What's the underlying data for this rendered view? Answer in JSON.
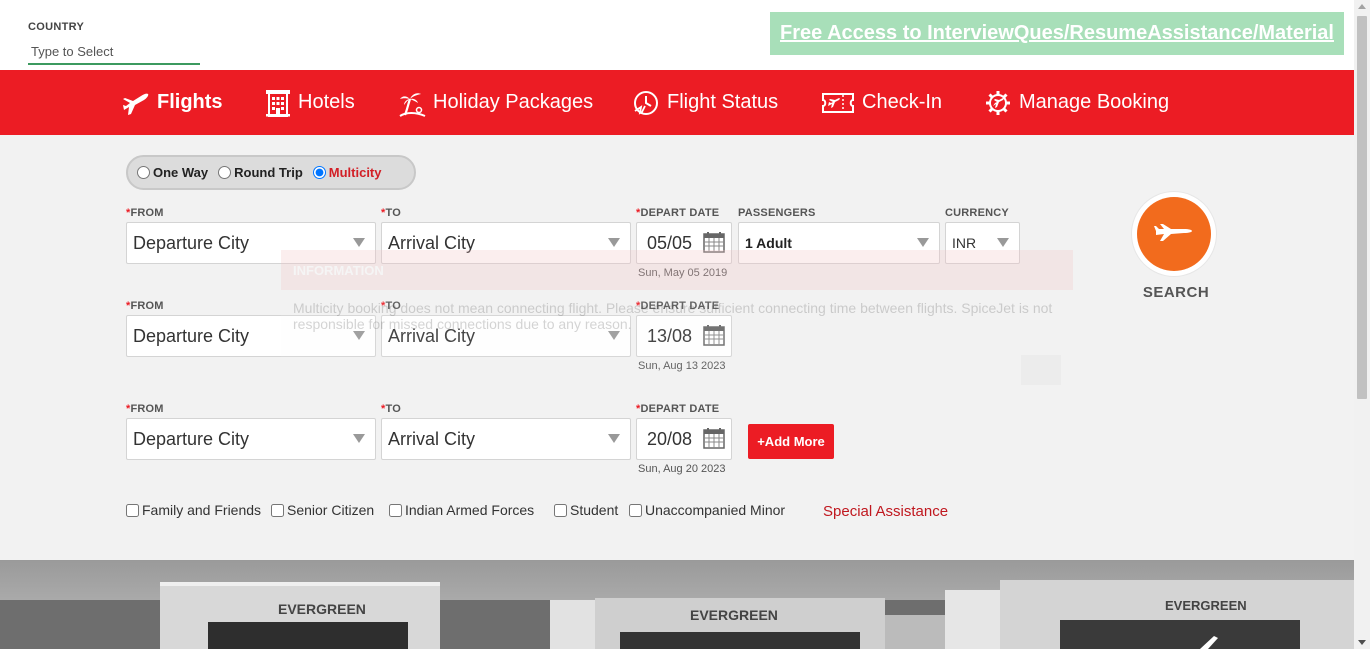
{
  "country": {
    "label": "COUNTRY",
    "placeholder": "Type to Select"
  },
  "promo": {
    "text": "Free Access to InterviewQues/ResumeAssistance/Material"
  },
  "nav": {
    "flights": "Flights",
    "hotels": "Hotels",
    "holiday": "Holiday Packages",
    "flight_status": "Flight Status",
    "checkin": "Check-In",
    "manage": "Manage Booking"
  },
  "trip_types": {
    "one_way": "One Way",
    "round_trip": "Round Trip",
    "multicity": "Multicity",
    "selected": "Multicity"
  },
  "labels": {
    "from": "FROM",
    "to": "TO",
    "depart_date": "DEPART DATE",
    "passengers": "PASSENGERS",
    "currency": "CURRENCY",
    "required_mark": "*"
  },
  "legs": [
    {
      "from": "Departure City",
      "to": "Arrival City",
      "date": "05/05",
      "date_long": "Sun, May 05 2019"
    },
    {
      "from": "Departure City",
      "to": "Arrival City",
      "date": "13/08",
      "date_long": "Sun, Aug 13 2023"
    },
    {
      "from": "Departure City",
      "to": "Arrival City",
      "date": "20/08",
      "date_long": "Sun, Aug 20 2023"
    }
  ],
  "passengers": "1 Adult",
  "currency": "INR",
  "add_more": "+Add More",
  "search": {
    "label": "SEARCH"
  },
  "info_popup": {
    "title": "INFORMATION",
    "body": "Multicity booking does not mean connecting flight. Please ensure sufficient connecting time between flights. SpiceJet is not responsible for missed connections due to any reason."
  },
  "concessions": {
    "family": "Family and Friends",
    "senior": "Senior Citizen",
    "armed": "Indian Armed Forces",
    "student": "Student",
    "minor": "Unaccompanied Minor"
  },
  "special_assistance": "Special Assistance",
  "banner_text": {
    "hangar_left": "EVERGREEN",
    "hangar_mid": "EVERGREEN",
    "hangar_right": "EVERGREEN"
  },
  "colors": {
    "brand_red": "#ec1c24",
    "search_orange": "#f26b1d",
    "promo_green": "#a8dfb9",
    "link_red": "#c0181f"
  }
}
